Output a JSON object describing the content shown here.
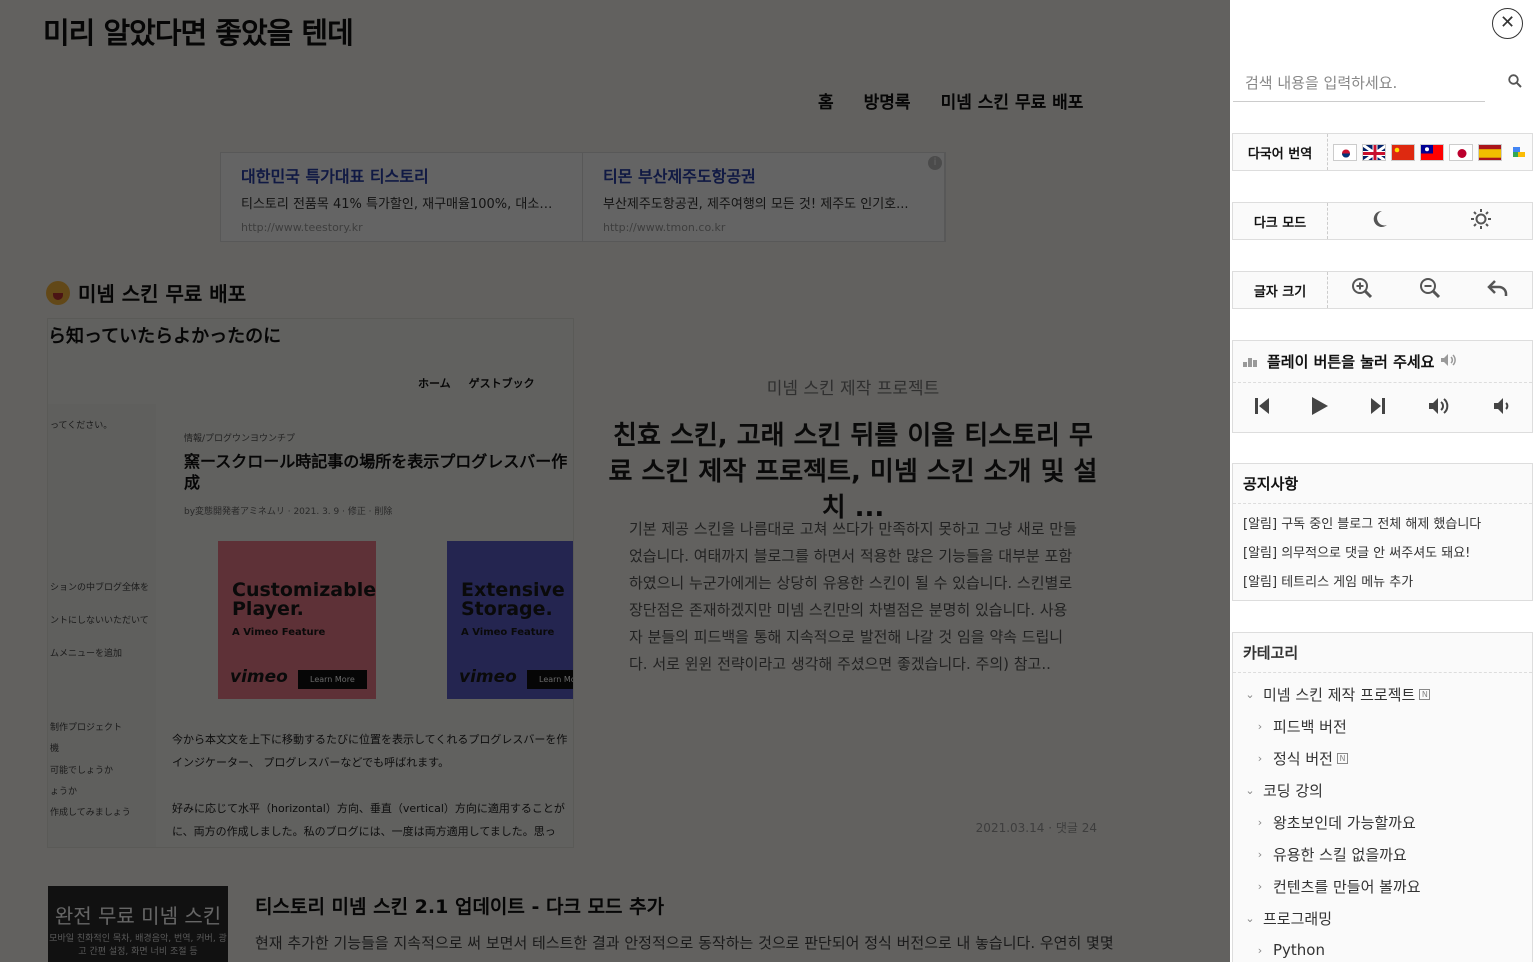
{
  "blog": {
    "title": "미리 알았다면 좋았을 텐데"
  },
  "nav": [
    "홈",
    "방명록",
    "미넴 스킨 무료 배포"
  ],
  "ads": [
    {
      "title": "대한민국 특가대표 티스토리",
      "desc": "티스토리 전품목 41% 특가할인, 재구매율100%, 대소량...",
      "url": "http://www.teestory.kr"
    },
    {
      "title": "티몬 부산제주도항공권",
      "desc": "부산제주도항공권, 제주여행의 모든 것! 제주도 인기호...",
      "url": "http://www.tmon.co.kr"
    }
  ],
  "ad_info": "i",
  "section_title": "미넴 스킨 무료 배포",
  "thumb": {
    "heading": "ら知っていたらよかったのに",
    "nav": [
      "ホーム",
      "ゲストブック"
    ],
    "left_lines": [
      "ってください。",
      "ションの中ブログ全体を",
      "ントにしないいただいて",
      "ムメニューを追加",
      "制作プロジェクト",
      "機",
      "可能でしょうか",
      "ょうか",
      "作成してみましょう"
    ],
    "category": "情報/プログウンヨウンチプ",
    "title": "窯ースクロール時記事の場所を表示プログレスバー作成",
    "meta": "by変態開発者アミネムリ · 2021. 3. 9 · 修正 · 削除",
    "ads": [
      {
        "big": "Customizable Player.",
        "small": "A Vimeo Feature",
        "logo": "vimeo",
        "cta": "Learn More"
      },
      {
        "big": "Extensive Storage.",
        "small": "A Vimeo Feature",
        "logo": "vimeo",
        "cta": "Learn Mo"
      }
    ],
    "body": [
      "今から本文文を上下に移動するたびに位置を表示してくれるプログレスバーを作",
      "インジケーター、 プログレスバーなどでも呼ばれます。",
      "好みに応じて水平（horizontal）方向、垂直（vertical）方向に適用することが",
      "に、両方の作成しました。私のブログには、一度は両方適用してました。思っ"
    ]
  },
  "featured": {
    "kicker": "미넴 스킨 제작 프로젝트",
    "title": "친효 스킨, 고래 스킨 뒤를 이을 티스토리 무료 스킨 제작 프로젝트, 미넴 스킨 소개 및 설치 ...",
    "excerpt": "기본 제공 스킨을 나름대로 고쳐 쓰다가 만족하지 못하고 그냥 새로 만들었습니다. 여태까지 블로그를 하면서 적용한 많은 기능들을 대부분 포함하였으니 누군가에게는 상당히 유용한 스킨이 될 수 있습니다. 스킨별로 장단점은 존재하겠지만 미넴 스킨만의 차별점은 분명히 있습니다. 사용자 분들의 피드백을 통해 지속적으로 발전해 나갈 것 임을 약속 드립니다. 서로 윈윈 전략이라고 생각해 주셨으면 좋겠습니다. 주의) 참고..",
    "meta": "2021.03.14 · 댓글 24"
  },
  "post2": {
    "thumb_title": "완전 무료 미넴 스킨",
    "thumb_sub": "모바일 친화적인 목차, 배경음악, 번역, 커버, 광고 간편 설정, 화면 너비 조절 등",
    "title": "티스토리 미넴 스킨 2.1 업데이트 - 다크 모드 추가",
    "body": "현재 추가한 기능들을 지속적으로 써 보면서 테스트한 결과 안정적으로 동작하는 것으로 판단되어 정식 버전으로 내 놓습니다. 우연히 몇몇"
  },
  "sidebar": {
    "close": "✕",
    "search": {
      "placeholder": "검색 내용을 입력하세요."
    },
    "translate_label": "다국어 번역",
    "dark_label": "다크 모드",
    "font_label": "글자 크기",
    "player": {
      "title": "플레이 버튼을 눌러 주세요"
    },
    "notice": {
      "title": "공지사항",
      "items": [
        "[알림] 구독 중인 블로그 전체 해제 했습니다",
        "[알림] 의무적으로 댓글 안 써주셔도 돼요!",
        "[알림] 테트리스 게임 메뉴 추가"
      ]
    },
    "category": {
      "title": "카테고리",
      "items": [
        {
          "label": "미넴 스킨 제작 프로젝트",
          "level": 0,
          "new": true
        },
        {
          "label": "피드백 버전",
          "level": 1,
          "new": false
        },
        {
          "label": "정식 버전",
          "level": 1,
          "new": true
        },
        {
          "label": "코딩 강의",
          "level": 0,
          "new": false
        },
        {
          "label": "왕초보인데 가능할까요",
          "level": 1,
          "new": false
        },
        {
          "label": "유용한 스킬 없을까요",
          "level": 1,
          "new": false
        },
        {
          "label": "컨텐츠를 만들어 볼까요",
          "level": 1,
          "new": false
        },
        {
          "label": "프로그래밍",
          "level": 0,
          "new": false
        },
        {
          "label": "Python",
          "level": 1,
          "new": false
        }
      ]
    },
    "new_badge": "N"
  },
  "icons": {
    "search": "search-icon",
    "moon": "moon-icon",
    "sun": "sun-icon",
    "zoom_in": "zoom-in-icon",
    "zoom_out": "zoom-out-icon",
    "reset": "undo-icon"
  },
  "colors": {
    "overlay": "rgba(0,0,0,0.6)",
    "ad_link": "#2a3fa8",
    "sidebar_bg": "#ffffff"
  }
}
